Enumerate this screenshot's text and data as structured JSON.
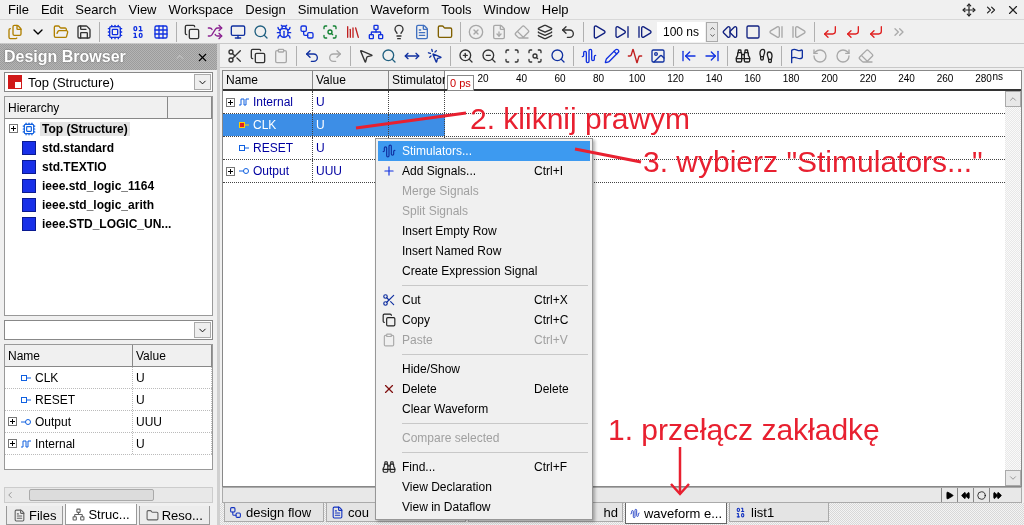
{
  "menu_bar": [
    {
      "label": "File"
    },
    {
      "label": "Edit"
    },
    {
      "label": "Search"
    },
    {
      "label": "View"
    },
    {
      "label": "Workspace"
    },
    {
      "label": "Design"
    },
    {
      "label": "Simulation"
    },
    {
      "label": "Waveform"
    },
    {
      "label": "Tools"
    },
    {
      "label": "Window"
    },
    {
      "label": "Help"
    }
  ],
  "time_step": "100 ns",
  "design_browser": {
    "title": "Design Browser",
    "top_selector": "Top (Structure)",
    "hierarchy_header": "Hierarchy",
    "tree": [
      {
        "label": "Top (Structure)",
        "kind": "entity",
        "expanded": false,
        "selected": true
      },
      {
        "label": "std.standard",
        "kind": "package",
        "selected": false
      },
      {
        "label": "std.TEXTIO",
        "kind": "package",
        "selected": false
      },
      {
        "label": "ieee.std_logic_1164",
        "kind": "package",
        "selected": false
      },
      {
        "label": "ieee.std_logic_arith",
        "kind": "package",
        "selected": false
      },
      {
        "label": "ieee.STD_LOGIC_UN...",
        "kind": "package",
        "selected": false
      }
    ],
    "signal_columns": [
      "Name",
      "Value"
    ],
    "signals": [
      {
        "name": "CLK",
        "value": "U",
        "kind": "input"
      },
      {
        "name": "RESET",
        "value": "U",
        "kind": "input"
      },
      {
        "name": "Output",
        "value": "UUU",
        "kind": "output",
        "expanded": false
      },
      {
        "name": "Internal",
        "value": "U",
        "kind": "internal",
        "expanded": false
      }
    ],
    "tabs": [
      {
        "label": "Files",
        "selected": false
      },
      {
        "label": "Struc...",
        "selected": true
      },
      {
        "label": "Reso...",
        "selected": false
      }
    ]
  },
  "waveform": {
    "columns": [
      "Name",
      "Value",
      "Stimulator"
    ],
    "ruler": [
      "20",
      "40",
      "60",
      "80",
      "100",
      "120",
      "140",
      "160",
      "180",
      "200",
      "220",
      "240",
      "260",
      "280"
    ],
    "unit": "ns",
    "cursor": "0 ps",
    "rows": [
      {
        "name": "Internal",
        "value": "U",
        "kind": "internal",
        "expanded": false,
        "selected": false
      },
      {
        "name": "CLK",
        "value": "U",
        "kind": "input",
        "selected": true
      },
      {
        "name": "RESET",
        "value": "U",
        "kind": "input",
        "selected": false
      },
      {
        "name": "Output",
        "value": "UUU",
        "kind": "output",
        "expanded": false,
        "selected": false
      }
    ]
  },
  "context_menu": [
    {
      "kind": "item",
      "label": "Stimulators...",
      "highlighted": true,
      "disabled": false
    },
    {
      "kind": "item",
      "label": "Add Signals...",
      "shortcut": "Ctrl+I",
      "highlighted": false,
      "disabled": false
    },
    {
      "kind": "item",
      "label": "Merge Signals",
      "highlighted": false,
      "disabled": true
    },
    {
      "kind": "item",
      "label": "Split Signals",
      "highlighted": false,
      "disabled": true
    },
    {
      "kind": "item",
      "label": "Insert Empty Row",
      "highlighted": false,
      "disabled": false
    },
    {
      "kind": "item",
      "label": "Insert Named Row",
      "highlighted": false,
      "disabled": false
    },
    {
      "kind": "item",
      "label": "Create Expression Signal",
      "highlighted": false,
      "disabled": false
    },
    {
      "kind": "separator"
    },
    {
      "kind": "item",
      "label": "Cut",
      "shortcut": "Ctrl+X",
      "highlighted": false,
      "disabled": false
    },
    {
      "kind": "item",
      "label": "Copy",
      "shortcut": "Ctrl+C",
      "highlighted": false,
      "disabled": false
    },
    {
      "kind": "item",
      "label": "Paste",
      "shortcut": "Ctrl+V",
      "highlighted": false,
      "disabled": true
    },
    {
      "kind": "separator"
    },
    {
      "kind": "item",
      "label": "Hide/Show",
      "highlighted": false,
      "disabled": false
    },
    {
      "kind": "item",
      "label": "Delete",
      "shortcut": "Delete",
      "highlighted": false,
      "disabled": false
    },
    {
      "kind": "item",
      "label": "Clear Waveform",
      "highlighted": false,
      "disabled": false
    },
    {
      "kind": "separator"
    },
    {
      "kind": "item",
      "label": "Compare selected",
      "highlighted": false,
      "disabled": true
    },
    {
      "kind": "separator"
    },
    {
      "kind": "item",
      "label": "Find...",
      "shortcut": "Ctrl+F",
      "highlighted": false,
      "disabled": false
    },
    {
      "kind": "item",
      "label": "View Declaration",
      "highlighted": false,
      "disabled": false
    },
    {
      "kind": "item",
      "label": "View in Dataflow",
      "highlighted": false,
      "disabled": false
    }
  ],
  "document_tabs": [
    {
      "label": "design flow",
      "selected": false
    },
    {
      "label": "cou",
      "selected": false
    },
    {
      "label": "hd",
      "selected": false
    },
    {
      "label": "waveform e...",
      "selected": true
    },
    {
      "label": "list1",
      "selected": false
    }
  ],
  "annotations": [
    {
      "text": "2. kliknij prawym"
    },
    {
      "text": "3. wybierz \"Stimulators...\""
    },
    {
      "text": "1. przełącz zakładkę"
    }
  ]
}
